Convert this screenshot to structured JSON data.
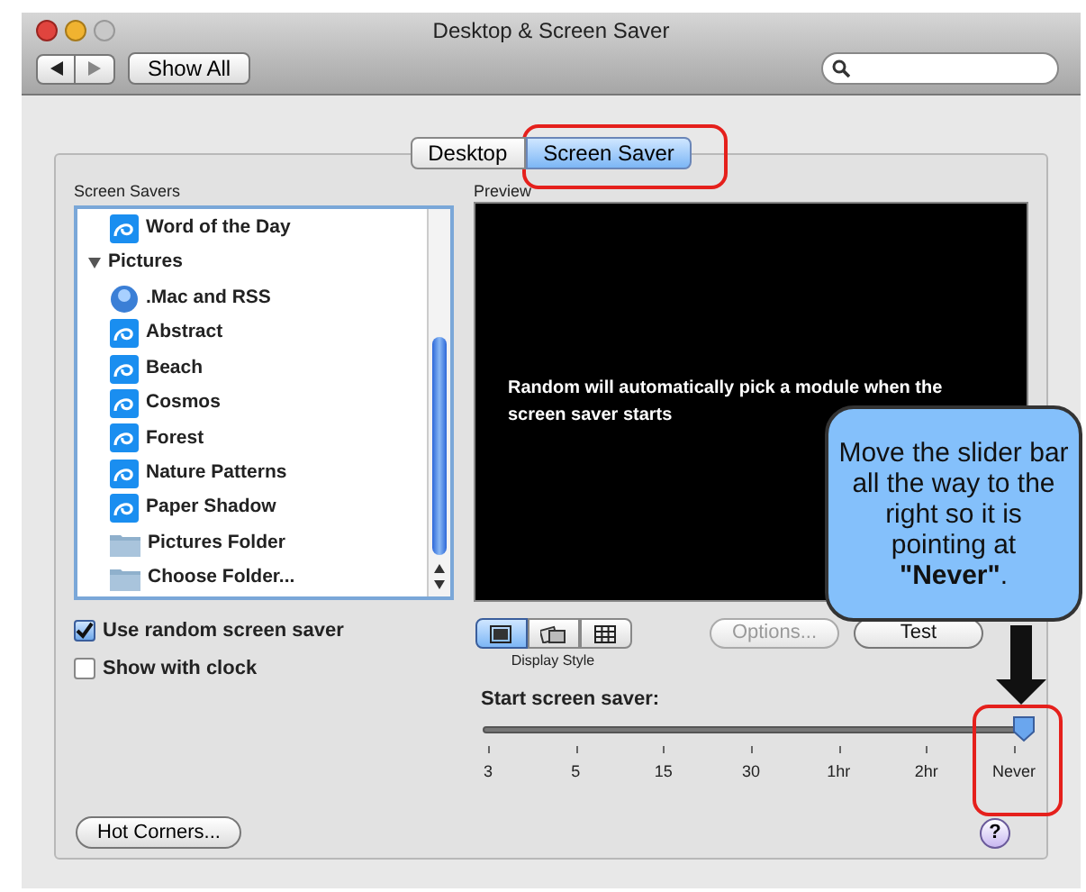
{
  "window": {
    "title": "Desktop & Screen Saver"
  },
  "toolbar": {
    "show_all": "Show All"
  },
  "tabs": [
    {
      "label": "Desktop",
      "selected": false
    },
    {
      "label": "Screen Saver",
      "selected": true
    }
  ],
  "screen_savers": {
    "label": "Screen Savers",
    "items": [
      {
        "label": "Word of the Day",
        "kind": "module"
      },
      {
        "label": "Pictures",
        "kind": "group",
        "expanded": true,
        "children": [
          {
            "label": ".Mac and RSS",
            "kind": "rss"
          },
          {
            "label": "Abstract",
            "kind": "module"
          },
          {
            "label": "Beach",
            "kind": "module"
          },
          {
            "label": "Cosmos",
            "kind": "module"
          },
          {
            "label": "Forest",
            "kind": "module"
          },
          {
            "label": "Nature Patterns",
            "kind": "module"
          },
          {
            "label": "Paper Shadow",
            "kind": "module"
          },
          {
            "label": "Pictures Folder",
            "kind": "folder"
          },
          {
            "label": "Choose Folder...",
            "kind": "folder"
          }
        ]
      }
    ]
  },
  "checkboxes": [
    {
      "label": "Use random screen saver",
      "checked": true
    },
    {
      "label": "Show with clock",
      "checked": false
    }
  ],
  "preview": {
    "label": "Preview",
    "message": "Random will automatically pick a module when the screen saver starts"
  },
  "display_style": {
    "label": "Display Style",
    "options": [
      {
        "kind": "screen",
        "selected": true
      },
      {
        "kind": "picture",
        "selected": false
      },
      {
        "kind": "grid",
        "selected": false
      }
    ]
  },
  "buttons": [
    {
      "label": "Options...",
      "disabled": true
    },
    {
      "label": "Test",
      "disabled": false
    }
  ],
  "slider": {
    "label": "Start screen saver:",
    "level": 1,
    "ticks": [
      "3",
      "5",
      "15",
      "30",
      "1hr",
      "2hr",
      "Never"
    ]
  },
  "hot_corners": "Hot Corners...",
  "help": "?",
  "callout": {
    "text": "Move the slider bar all the way to the right so it is pointing at **\"Never\"**."
  }
}
